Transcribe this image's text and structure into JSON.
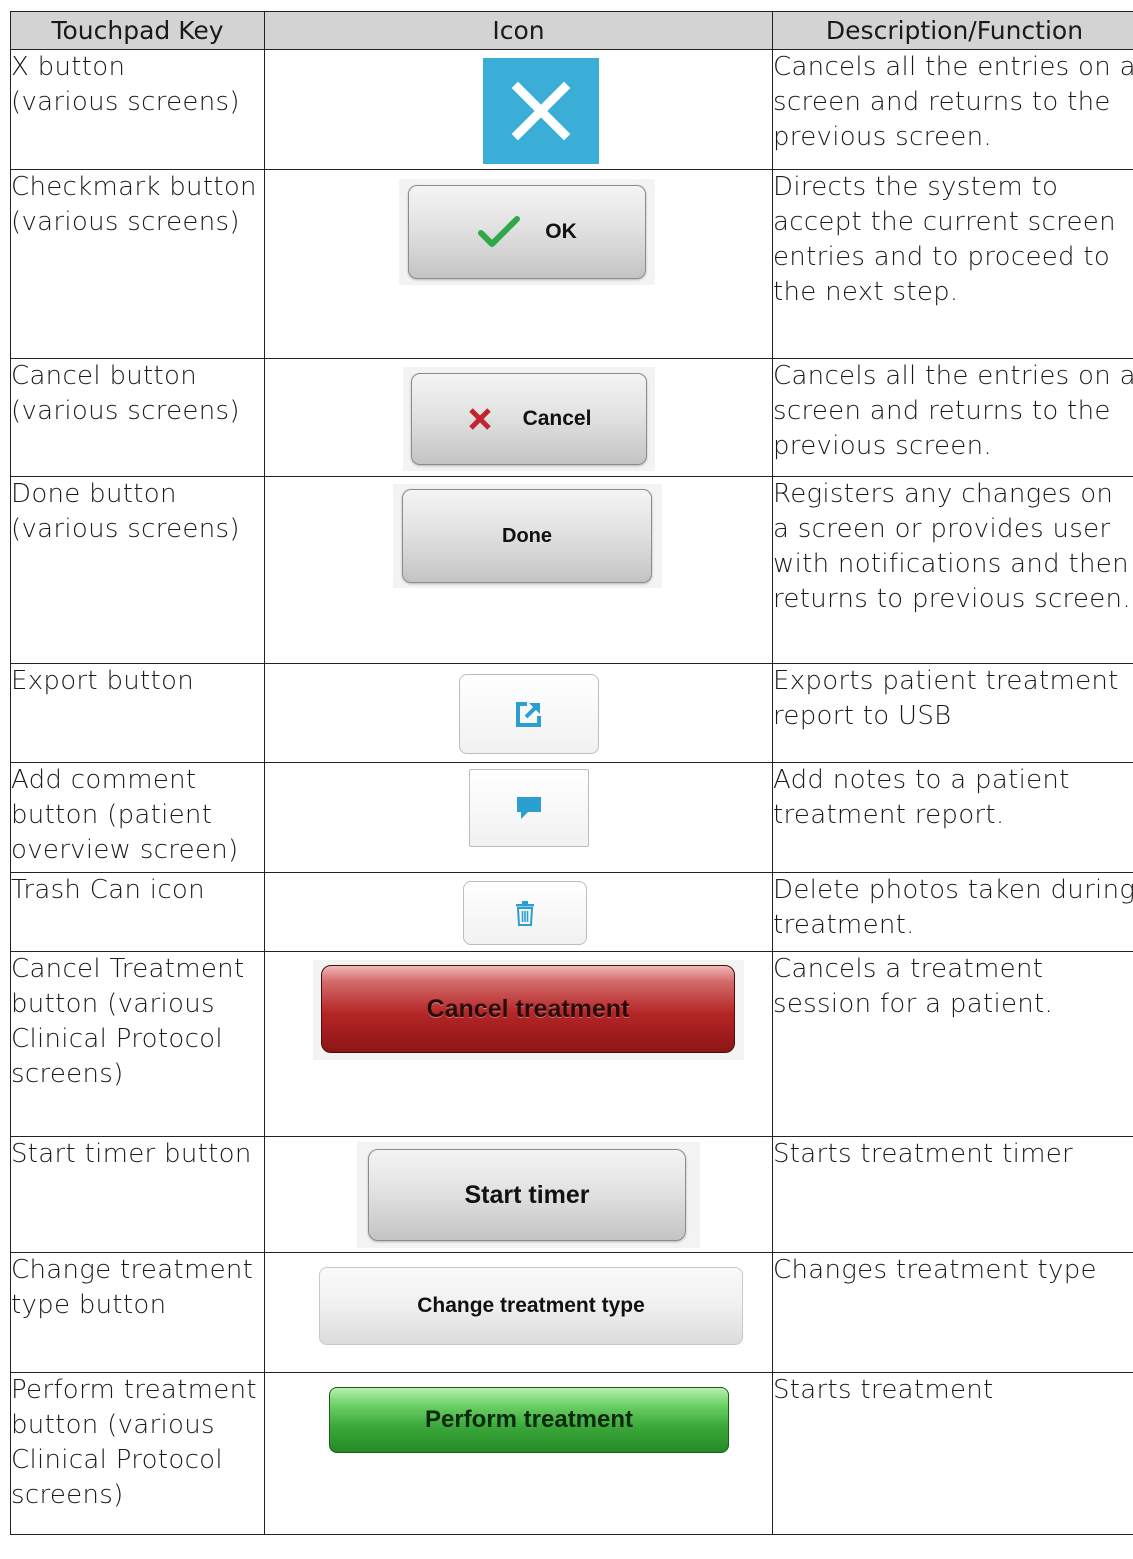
{
  "headers": {
    "key": "Touchpad Key",
    "icon": "Icon",
    "desc": "Description/Function"
  },
  "rows": [
    {
      "key": "X button\n(various screens)",
      "icon": "x-icon",
      "desc": "Cancels all the entries on a screen and returns to the previous screen."
    },
    {
      "key": "Checkmark button\n(various screens)",
      "icon": "ok-button",
      "label": "OK",
      "desc": "Directs the system to accept the current screen entries and to proceed to the next step."
    },
    {
      "key": "Cancel button\n(various screens)",
      "icon": "cancel-button",
      "label": "Cancel",
      "desc": "Cancels all the entries on a screen and returns to the previous screen."
    },
    {
      "key": "Done button\n(various screens)",
      "icon": "done-button",
      "label": "Done",
      "desc": "Registers any changes on a screen or provides user with notifications and then returns to previous screen."
    },
    {
      "key": "Export button",
      "icon": "export-icon",
      "desc": "Exports patient treatment report to USB"
    },
    {
      "key": "Add comment button (patient overview screen)",
      "icon": "comment-icon",
      "desc": "Add notes to a patient treatment report."
    },
    {
      "key": "Trash Can icon",
      "icon": "trash-icon",
      "desc": "Delete photos taken during treatment."
    },
    {
      "key": "Cancel Treatment button (various Clinical Protocol screens)",
      "icon": "cancel-treatment-button",
      "label": "Cancel treatment",
      "desc": "Cancels a treatment session for a patient."
    },
    {
      "key": "Start timer button",
      "icon": "start-timer-button",
      "label": "Start timer",
      "desc": "Starts treatment timer"
    },
    {
      "key": "Change treatment type button",
      "icon": "change-treatment-type-button",
      "label": "Change treatment type",
      "desc": "Changes treatment type"
    },
    {
      "key": "Perform treatment button (various Clinical Protocol screens)",
      "icon": "perform-treatment-button",
      "label": "Perform treatment",
      "desc": "Starts treatment"
    }
  ],
  "colors": {
    "header_bg": "#d3d3d3",
    "x_blue": "#3aaed6",
    "check_green": "#2fa84a",
    "cancel_red": "#c0262b",
    "icon_blue": "#2a9fd0"
  }
}
